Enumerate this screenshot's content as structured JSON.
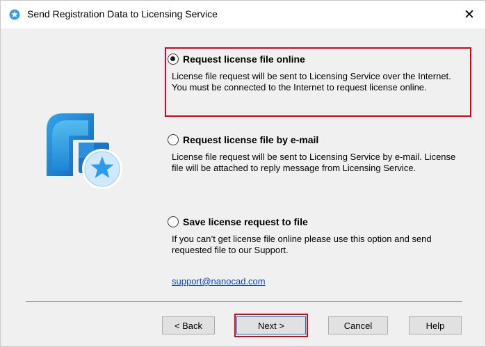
{
  "window": {
    "title": "Send Registration Data to Licensing Service",
    "title_icon": "star-badge-icon",
    "close_label": "✕"
  },
  "logo": {
    "icon": "nanocad-license-logo-icon"
  },
  "options": [
    {
      "label": "Request license file online",
      "selected": true,
      "description": "License file request will be sent to Licensing Service over the Internet. You must be connected to the Internet to request license online."
    },
    {
      "label": "Request license file by e-mail",
      "selected": false,
      "description": "License file request will be sent to Licensing Service by e-mail. License file will be attached to reply message from Licensing Service."
    },
    {
      "label": "Save license request to file",
      "selected": false,
      "description": "If you can’t get license file online please use this option and send requested file to our Support."
    }
  ],
  "support_email": "support@nanocad.com",
  "buttons": {
    "back": "< Back",
    "next": "Next >",
    "cancel": "Cancel",
    "help": "Help"
  },
  "colors": {
    "highlight": "#e0001b",
    "logo_blue": "#1e88d6",
    "link": "#0645c8"
  }
}
